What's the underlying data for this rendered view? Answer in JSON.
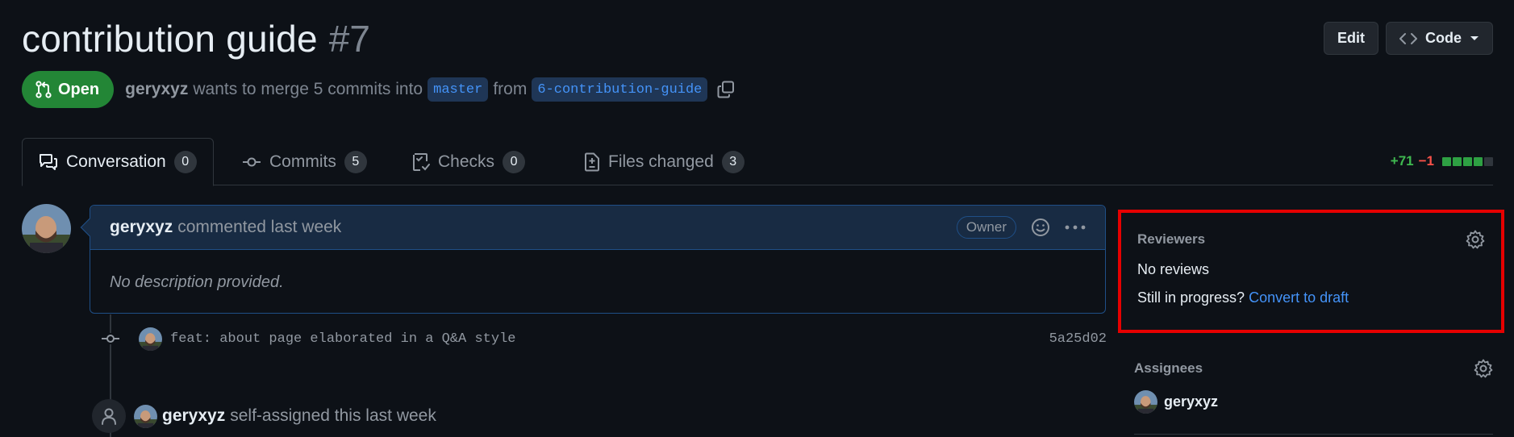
{
  "pr": {
    "title": "contribution guide",
    "number": "#7",
    "state": "Open",
    "author": "geryxyz",
    "merge_text": "wants to merge 5 commits into",
    "base_branch": "master",
    "from_text": "from",
    "head_branch": "6-contribution-guide"
  },
  "header_actions": {
    "edit_label": "Edit",
    "code_label": "Code"
  },
  "tabs": [
    {
      "label": "Conversation",
      "count": "0"
    },
    {
      "label": "Commits",
      "count": "5"
    },
    {
      "label": "Checks",
      "count": "0"
    },
    {
      "label": "Files changed",
      "count": "3"
    }
  ],
  "diffstat": {
    "additions": "+71",
    "deletions": "−1",
    "blocks": [
      "#2ea043",
      "#2ea043",
      "#2ea043",
      "#2ea043",
      "#30363d"
    ]
  },
  "comment": {
    "author": "geryxyz",
    "action": "commented last week",
    "role_badge": "Owner",
    "body": "No description provided."
  },
  "commit": {
    "message": "feat: about page elaborated in a Q&A style",
    "sha": "5a25d02"
  },
  "event": {
    "author": "geryxyz",
    "text": "self-assigned this last week"
  },
  "sidebar": {
    "reviewers_title": "Reviewers",
    "reviewers_value": "No reviews",
    "draft_prompt": "Still in progress?",
    "draft_link": "Convert to draft",
    "assignees_title": "Assignees",
    "assignee_name": "geryxyz"
  },
  "colors": {
    "open_green": "#238636",
    "link_blue": "#4493f8",
    "highlight_red": "#e60000"
  }
}
